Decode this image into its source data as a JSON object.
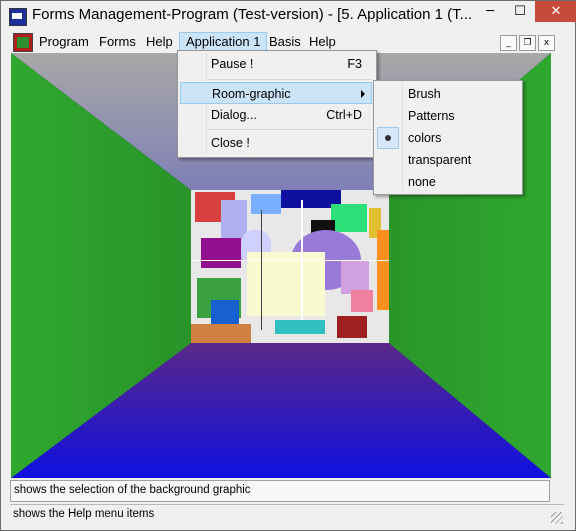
{
  "window": {
    "title": "Forms Management-Program (Test-version) - [5. Application 1 (T...",
    "minimize_label": "─",
    "maximize_label": "☐",
    "close_label": "✕"
  },
  "menubar": {
    "items": [
      {
        "label": "Program"
      },
      {
        "label": "Forms"
      },
      {
        "label": "Help"
      },
      {
        "label": "Application 1"
      },
      {
        "label": "Basis"
      },
      {
        "label": "Help"
      }
    ],
    "mdi_buttons": {
      "minimize": "_",
      "restore": "❐",
      "close": "x"
    }
  },
  "dropdown": {
    "items": [
      {
        "label": "Pause !",
        "shortcut": "F3"
      },
      {
        "label": "Room-graphic",
        "shortcut": ""
      },
      {
        "label": "Dialog...",
        "shortcut": "Ctrl+D"
      },
      {
        "label": "Close !",
        "shortcut": ""
      }
    ]
  },
  "submenu": {
    "items": [
      {
        "label": "Brush"
      },
      {
        "label": "Patterns"
      },
      {
        "label": "colors",
        "checked": true
      },
      {
        "label": "transparent"
      },
      {
        "label": "none"
      }
    ]
  },
  "status": {
    "line1": "shows the selection of the background graphic",
    "line2": "shows the Help menu items"
  },
  "colors": {
    "close_button": "#c74a3a",
    "highlight": "#cce4f7",
    "walls": "#2fa82f",
    "floor": "#c04a10",
    "ceiling": "#2a2ad4"
  }
}
